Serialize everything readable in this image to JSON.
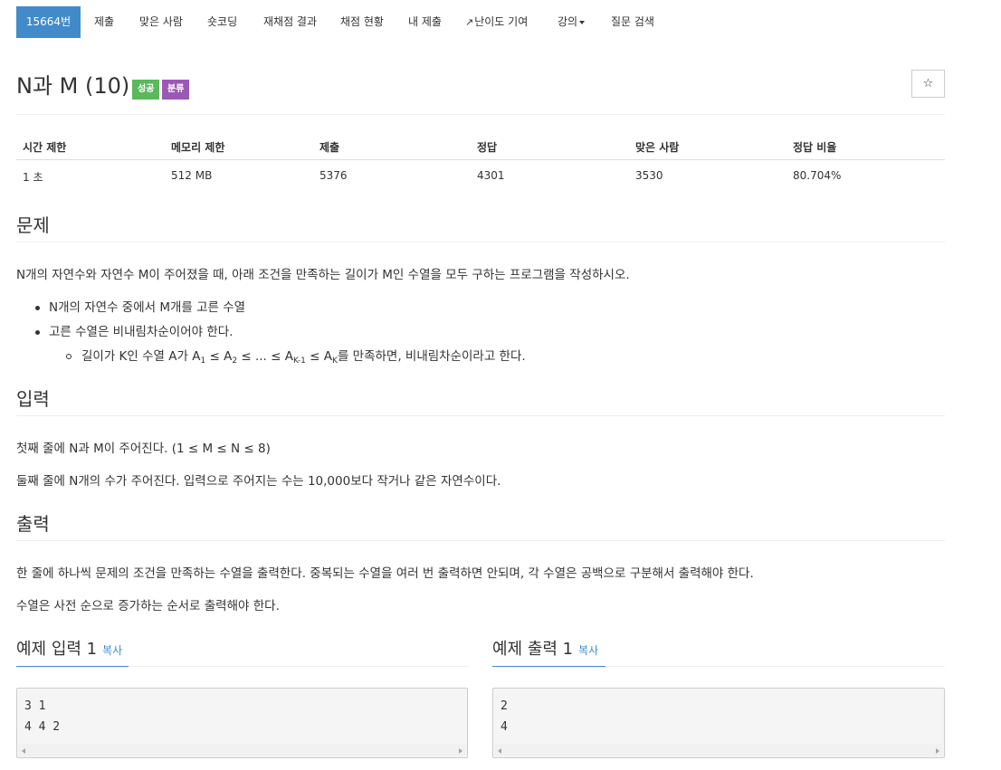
{
  "tabs": {
    "problem_id": "15664번",
    "submit": "제출",
    "solved_users": "맞은 사람",
    "short_coding": "숏코딩",
    "rejudge": "재채점 결과",
    "status": "채점 현황",
    "my_submissions": "내 제출",
    "difficulty": "난이도 기여",
    "lecture": "강의",
    "qna": "질문 검색"
  },
  "icons": {
    "external": "external-link-icon",
    "caret": "caret-down-icon",
    "star": "star-icon"
  },
  "problem": {
    "title": "N과 M (10)",
    "label_success": "성공",
    "label_category": "분류",
    "star": "☆"
  },
  "stats": {
    "headers": [
      "시간 제한",
      "메모리 제한",
      "제출",
      "정답",
      "맞은 사람",
      "정답 비율"
    ],
    "values": [
      "1 초",
      "512 MB",
      "5376",
      "4301",
      "3530",
      "80.704%"
    ]
  },
  "description": {
    "heading": "문제",
    "intro": "N개의 자연수와 자연수 M이 주어졌을 때, 아래 조건을 만족하는 길이가 M인 수열을 모두 구하는 프로그램을 작성하시오.",
    "bullet1": "N개의 자연수 중에서 M개를 고른 수열",
    "bullet2": "고른 수열은 비내림차순이어야 한다.",
    "sub_pre": "길이가 K인 수열 A가 A",
    "sub_1": "1",
    "sub_le1": " ≤ A",
    "sub_2": "2",
    "sub_mid": " ≤ ... ≤ A",
    "sub_k1": "K-1",
    "sub_le2": " ≤ A",
    "sub_k": "K",
    "sub_post": "를 만족하면, 비내림차순이라고 한다."
  },
  "input": {
    "heading": "입력",
    "line1": "첫째 줄에 N과 M이 주어진다. (1 ≤ M ≤ N ≤ 8)",
    "line2": "둘째 줄에 N개의 수가 주어진다. 입력으로 주어지는 수는 10,000보다 작거나 같은 자연수이다."
  },
  "output": {
    "heading": "출력",
    "line1": "한 줄에 하나씩 문제의 조건을 만족하는 수열을 출력한다. 중복되는 수열을 여러 번 출력하면 안되며, 각 수열은 공백으로 구분해서 출력해야 한다.",
    "line2": "수열은 사전 순으로 증가하는 순서로 출력해야 한다."
  },
  "samples": {
    "input_heading": "예제 입력 1",
    "output_heading": "예제 출력 1",
    "copy": "복사",
    "input_text": "3 1\n4 4 2",
    "output_text": "2\n4"
  }
}
